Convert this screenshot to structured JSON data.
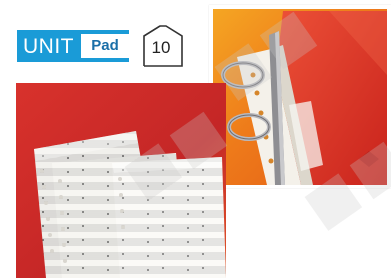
{
  "badge": {
    "unit_label": "UNIT",
    "unit_value": "Pad"
  },
  "pack_count": {
    "value": "10",
    "icon": "package-count-icon"
  },
  "photos": {
    "binder": {
      "icon": "binder-photo"
    },
    "music_sheets": {
      "icon": "sheet-protectors-photo"
    }
  },
  "colors": {
    "badge_blue": "#1a9bd7",
    "binder_red": "#e03a2a",
    "background_red": "#c8282a",
    "background_orange": "#f08a1c"
  }
}
